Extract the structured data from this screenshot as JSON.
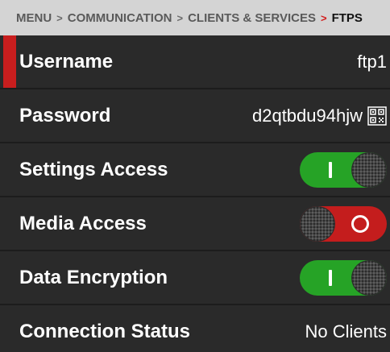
{
  "breadcrumb": {
    "items": [
      "MENU",
      "COMMUNICATION",
      "CLIENTS & SERVICES",
      "FTPS"
    ],
    "separator": ">"
  },
  "rows": [
    {
      "label": "Username",
      "value": "ftp1"
    },
    {
      "label": "Password",
      "value": "d2qtbdu94hjw",
      "icon": "qr-code-icon"
    },
    {
      "label": "Settings Access",
      "toggle": "on"
    },
    {
      "label": "Media Access",
      "toggle": "off"
    },
    {
      "label": "Data Encryption",
      "toggle": "on"
    },
    {
      "label": "Connection Status",
      "value": "No Clients"
    }
  ],
  "colors": {
    "accent": "#c81e1e",
    "toggle_on": "#26a326",
    "toggle_off": "#c41d1d",
    "background": "#2a2a2a",
    "breadcrumb_bg": "#d4d4d4"
  }
}
